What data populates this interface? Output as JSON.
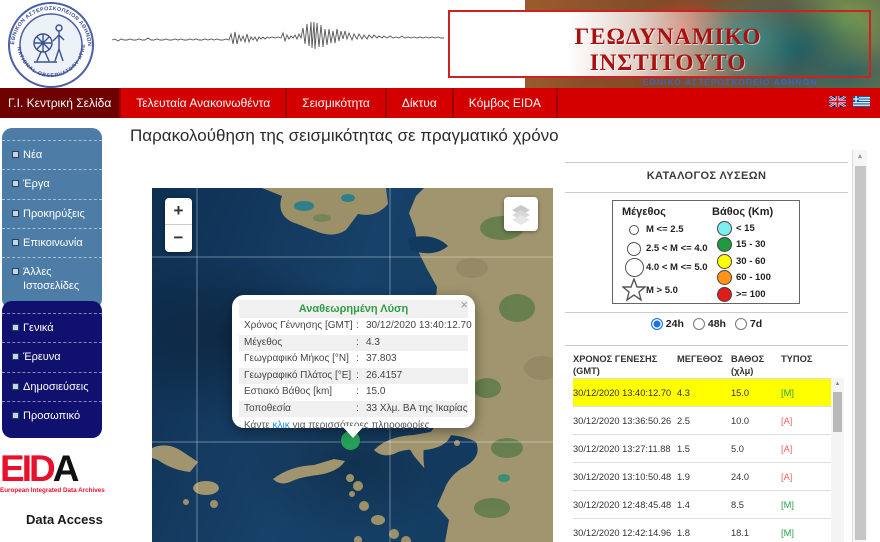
{
  "header": {
    "logo": {
      "ring_top": "ΕΘΝΙΚΟΝ ΑΣΤΕΡΟΣΚΟΠΕΙΟΝ ΑΘΗΝΩΝ",
      "ring_bottom": "NATIONAL OBSERVATORY ATHENS"
    },
    "banner": {
      "title": "ΓΕΩΔΥΝΑΜΙΚΟ ΙΝΣΤΙΤΟΥΤΟ",
      "subtitle": "ΕΘΝΙΚΟ ΑΣΤΕΡΟΣΚΟΠΕΙΟ ΑΘΗΝΩΝ"
    }
  },
  "nav": {
    "items": [
      {
        "label": "Γ.Ι. Κεντρική Σελίδα",
        "active": true
      },
      {
        "label": "Τελευταία Ανακοινωθέντα",
        "active": false
      },
      {
        "label": "Σεισμικότητα",
        "active": false
      },
      {
        "label": "Δίκτυα",
        "active": false
      },
      {
        "label": "Κόμβος EIDA",
        "active": false
      }
    ],
    "flags": [
      "uk",
      "greece"
    ]
  },
  "sidebar": {
    "box1_items": [
      "Νέα",
      "Έργα",
      "Προκηρύξεις",
      "Επικοινωνία",
      "Άλλες Ιστοσελίδες"
    ],
    "box2_items": [
      "Γενικά",
      "Έρευνα",
      "Δημοσιεύσεις",
      "Προσωπικό"
    ],
    "eida": {
      "logo_e": "E",
      "logo_i": "I",
      "logo_d": "D",
      "logo_a": "A",
      "tagline": "European Integrated Data Archives",
      "data_access": "Data Access"
    }
  },
  "main": {
    "title": "Παρακολούθηση της σεισμικότητας σε πραγματικό χρόνο"
  },
  "map": {
    "zoom_in": "+",
    "zoom_out": "−",
    "marker_color": "#27a05a",
    "popup": {
      "title": "Αναθεωρημένη Λύση",
      "separator": ":",
      "close_glyph": "×",
      "rows": [
        {
          "label": "Χρόνος Γέννησης [GMT]",
          "value": "30/12/2020 13:40:12.70"
        },
        {
          "label": "Μέγεθος",
          "value": "4.3"
        },
        {
          "label": "Γεωγραφικό Μήκος [°N]",
          "value": "37.803"
        },
        {
          "label": "Γεωγραφικό Πλάτος [°E]",
          "value": "26.4157"
        },
        {
          "label": "Εστιακό Βάθος [km]",
          "value": "15.0"
        },
        {
          "label": "Τοποθεσία",
          "value": "33 Χλμ. ΒΑ της Ικαρίας"
        }
      ],
      "footer_prefix": "Κάντε",
      "footer_link": "κλικ",
      "footer_suffix": "για περισσότερες πληροφορίες"
    }
  },
  "panel": {
    "heading": "ΚΑΤΑΛΟΓΟΣ ΛΥΣΕΩΝ",
    "legend": {
      "magnitude_title": "Μέγεθος",
      "magnitude_items": [
        {
          "label": "M <= 2.5"
        },
        {
          "label": "2.5 < M <= 4.0"
        },
        {
          "label": "4.0 < M <= 5.0"
        },
        {
          "label": "M > 5.0"
        }
      ],
      "depth_title": "Βάθος (Km)",
      "depth_items": [
        {
          "label": "< 15",
          "color": "#7deef0"
        },
        {
          "label": "15 - 30",
          "color": "#1e9b3f"
        },
        {
          "label": "30 - 60",
          "color": "#ffff00"
        },
        {
          "label": "60 - 100",
          "color": "#ff9417"
        },
        {
          "label": ">= 100",
          "color": "#e11a1a"
        }
      ]
    },
    "range_options": [
      {
        "label": "24h",
        "selected": true
      },
      {
        "label": "48h",
        "selected": false
      },
      {
        "label": "7d",
        "selected": false
      }
    ],
    "table": {
      "headers": [
        {
          "line1": "ΧΡΟΝΟΣ ΓΕΝΕΣΗΣ",
          "line2": "(GMT)"
        },
        {
          "line1": "ΜΕΓΕΘΟΣ",
          "line2": ""
        },
        {
          "line1": "ΒΑΘΟΣ",
          "line2": "(χλμ)"
        },
        {
          "line1": "ΤΥΠΟΣ",
          "line2": ""
        }
      ],
      "rows": [
        {
          "time": "30/12/2020 13:40:12.70",
          "magnitude": "4.3",
          "depth": "15.0",
          "type": "[M]",
          "type_class": "M",
          "highlighted": true
        },
        {
          "time": "30/12/2020 13:36:50.26",
          "magnitude": "2.5",
          "depth": "10.0",
          "type": "[A]",
          "type_class": "A",
          "highlighted": false
        },
        {
          "time": "30/12/2020 13:27:11.88",
          "magnitude": "1.5",
          "depth": "5.0",
          "type": "[A]",
          "type_class": "A",
          "highlighted": false
        },
        {
          "time": "30/12/2020 13:10:50.48",
          "magnitude": "1.9",
          "depth": "24.0",
          "type": "[A]",
          "type_class": "A",
          "highlighted": false
        },
        {
          "time": "30/12/2020 12:48:45.48",
          "magnitude": "1.4",
          "depth": "8.5",
          "type": "[M]",
          "type_class": "M",
          "highlighted": false
        },
        {
          "time": "30/12/2020 12:42:14.96",
          "magnitude": "1.8",
          "depth": "18.1",
          "type": "[M]",
          "type_class": "M",
          "highlighted": false
        }
      ]
    }
  },
  "ui": {
    "scroll_up_glyph": "▲"
  },
  "colors": {
    "nav_red": "#d40000",
    "nav_active_maroon": "#6f0000",
    "highlight_yellow": "#ffff00",
    "type_manual_green": "#27a348",
    "type_auto_red": "#f0635c",
    "sidebar_blue": "#4d7da7",
    "sidebar_navy": "#10106e",
    "banner_title_red": "#a91111",
    "eida_red": "#e8112d",
    "popup_title_green": "#2f9e44",
    "radio_blue": "#1a73e8"
  }
}
